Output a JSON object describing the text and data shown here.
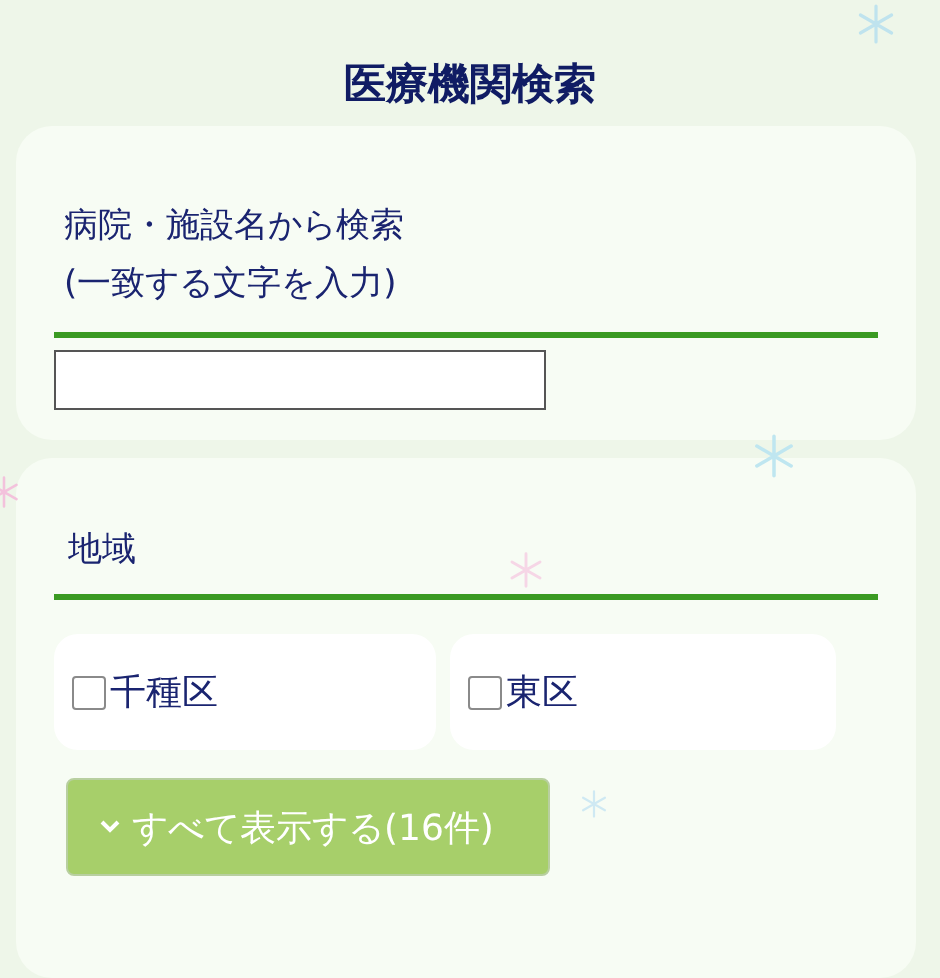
{
  "title": "医療機関検索",
  "search": {
    "label_lines": [
      "病院・施設名から検索",
      "(一致する文字を入力)"
    ]
  },
  "region": {
    "heading": "地域",
    "options": [
      {
        "label": "千種区",
        "checked": false
      },
      {
        "label": "東区",
        "checked": false
      }
    ],
    "show_all_button": "すべて表示する(16件)"
  }
}
